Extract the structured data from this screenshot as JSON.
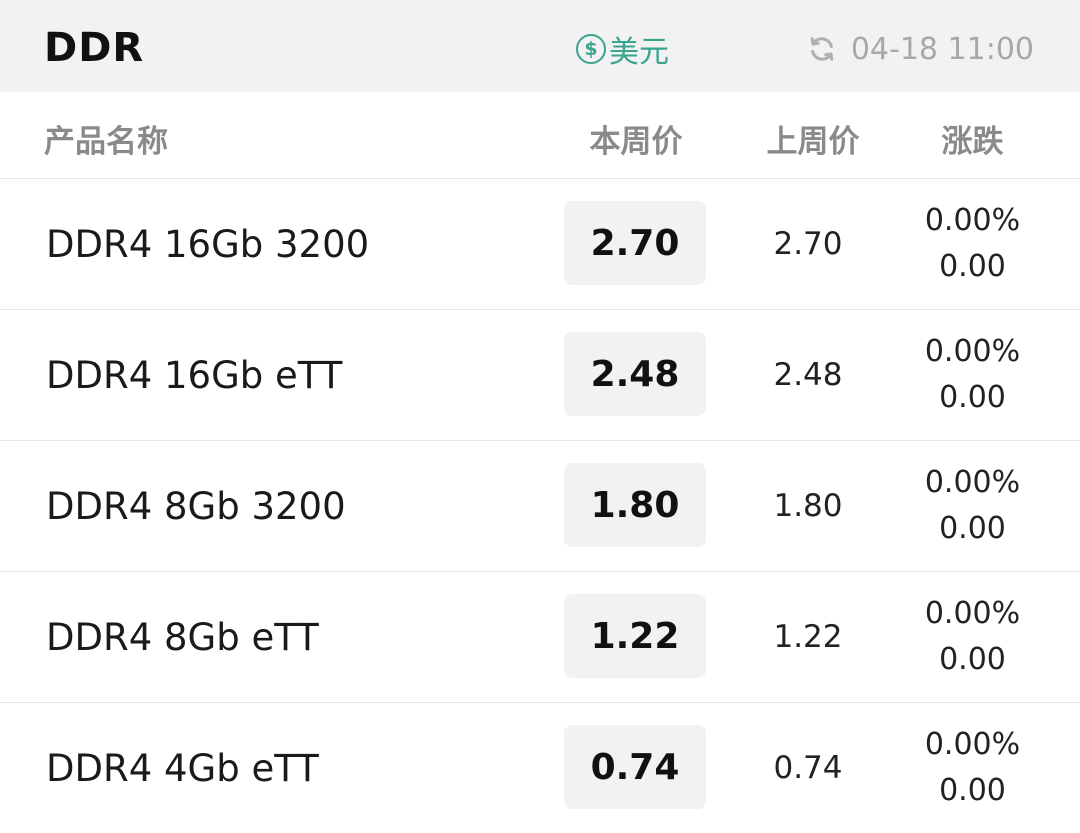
{
  "header": {
    "title": "DDR",
    "currency": {
      "symbol": "$",
      "label": "美元",
      "color": "#3aa58e"
    },
    "updated": {
      "icon": "refresh-icon",
      "time": "04-18 11:00"
    }
  },
  "table": {
    "columns": {
      "name": "产品名称",
      "current": "本周价",
      "previous": "上周价",
      "change": "涨跌"
    },
    "rows": [
      {
        "name": "DDR4 16Gb 3200",
        "current": "2.70",
        "previous": "2.70",
        "change_pct": "0.00%",
        "change_abs": "0.00"
      },
      {
        "name": "DDR4 16Gb eTT",
        "current": "2.48",
        "previous": "2.48",
        "change_pct": "0.00%",
        "change_abs": "0.00"
      },
      {
        "name": "DDR4 8Gb 3200",
        "current": "1.80",
        "previous": "1.80",
        "change_pct": "0.00%",
        "change_abs": "0.00"
      },
      {
        "name": "DDR4 8Gb eTT",
        "current": "1.22",
        "previous": "1.22",
        "change_pct": "0.00%",
        "change_abs": "0.00"
      },
      {
        "name": "DDR4 4Gb eTT",
        "current": "0.74",
        "previous": "0.74",
        "change_pct": "0.00%",
        "change_abs": "0.00"
      }
    ]
  }
}
